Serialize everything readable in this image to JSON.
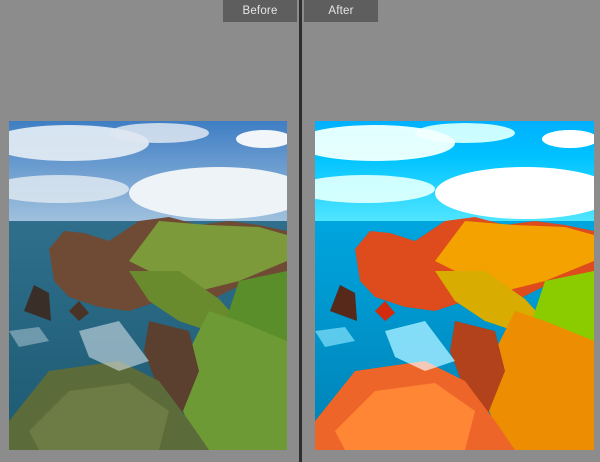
{
  "labels": {
    "before": "Before",
    "after": "After"
  },
  "colors": {
    "background": "#8c8c8c",
    "label_background": "#5e5e5e",
    "label_text": "#e6e6e6",
    "divider": "#2e2e2e"
  },
  "icons": {
    "before_photo": "coastal-cliffs-photo",
    "after_photo": "coastal-cliffs-photo-edited"
  }
}
